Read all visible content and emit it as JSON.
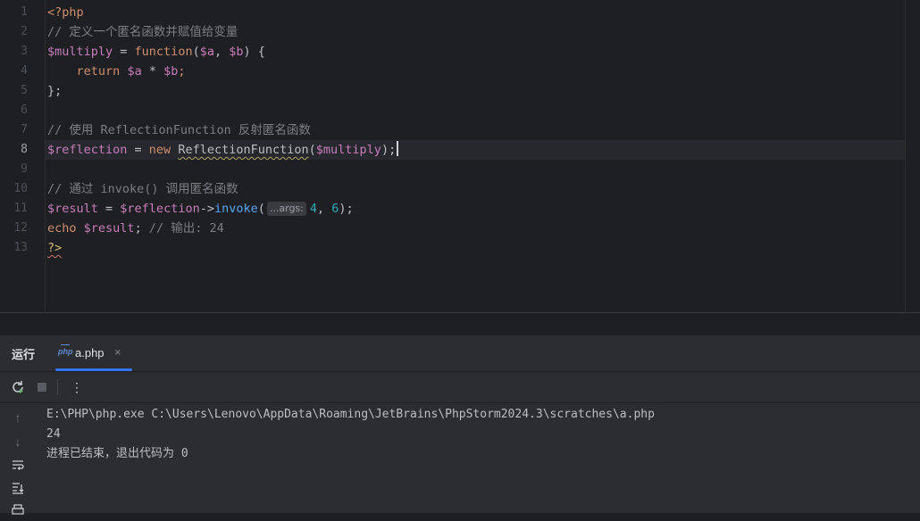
{
  "editor": {
    "line_numbers": [
      "1",
      "2",
      "3",
      "4",
      "5",
      "6",
      "7",
      "8",
      "9",
      "10",
      "11",
      "12",
      "13"
    ],
    "current_line": "8",
    "lines": {
      "l1": "<?php",
      "l2": "// 定义一个匿名函数并赋值给变量",
      "l3": {
        "var": "$multiply",
        "eq": " = ",
        "kw": "function",
        "open": "(",
        "a": "$a",
        "comma": ", ",
        "b": "$b",
        "close": ") {"
      },
      "l4": {
        "indent": "    ",
        "kw": "return",
        "sp": " ",
        "a": "$a",
        "op": " * ",
        "b": "$b",
        "semi": ";"
      },
      "l5": "};",
      "l7": "// 使用 ReflectionFunction 反射匿名函数",
      "l8": {
        "var": "$reflection",
        "eq": " = ",
        "kw": "new",
        "sp": " ",
        "cls": "ReflectionFunction",
        "open": "(",
        "arg": "$multiply",
        "close": ");"
      },
      "l10": "// 通过 invoke() 调用匿名函数",
      "l11": {
        "var": "$result",
        "eq": " = ",
        "obj": "$reflection",
        "arrow": "->",
        "meth": "invoke",
        "open": "(",
        "hint": "...args:",
        "n1": "4",
        "comma": ", ",
        "n2": "6",
        "close": ");"
      },
      "l12": {
        "kw": "echo",
        "sp": " ",
        "var": "$result",
        "semi": "; ",
        "cmt": "// 输出: 24"
      },
      "l13": "?>"
    }
  },
  "run_panel": {
    "title": "运行",
    "tab": {
      "icon": "php-file-icon",
      "label": "a.php",
      "close": "×"
    },
    "output": [
      "E:\\PHP\\php.exe C:\\Users\\Lenovo\\AppData\\Roaming\\JetBrains\\PhpStorm2024.3\\scratches\\a.php",
      "24",
      "进程已结束，退出代码为 0"
    ]
  },
  "colors": {
    "editor_bg": "#1e1f22",
    "panel_bg": "#2b2d30",
    "keyword": "#cf8e6d",
    "variable": "#c77dbb",
    "comment": "#7a7e85",
    "number": "#2aacb8",
    "method": "#56a8f5",
    "accent": "#3574f0"
  }
}
